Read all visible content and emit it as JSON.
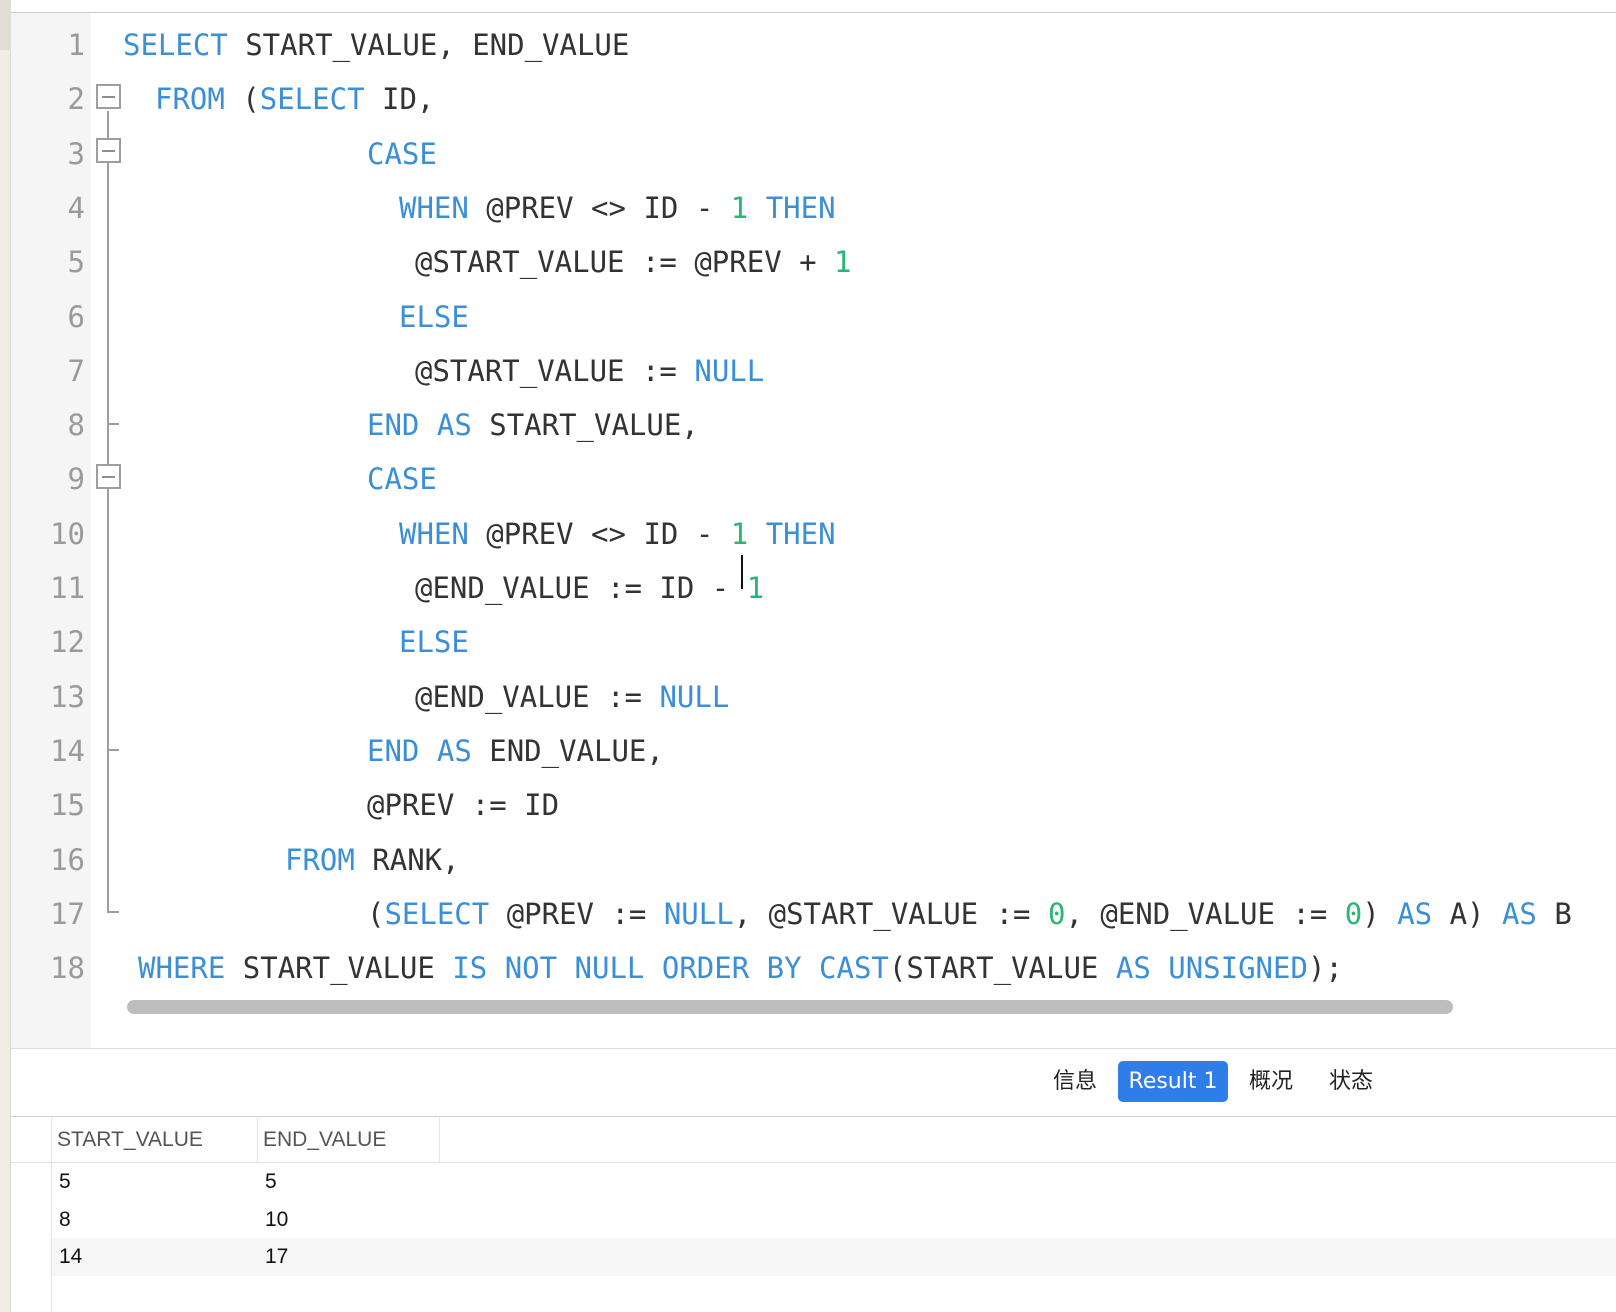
{
  "editor": {
    "lines": [
      {
        "num": "1",
        "tokens": [
          {
            "t": "SELECT",
            "k": "kw"
          },
          {
            "t": " START_VALUE, END_VALUE",
            "k": "id"
          }
        ]
      },
      {
        "num": "2",
        "tokens": [
          {
            "t": "FROM",
            "k": "kw"
          },
          {
            "t": " (",
            "k": "id"
          },
          {
            "t": "SELECT",
            "k": "kw"
          },
          {
            "t": " ID,",
            "k": "id"
          }
        ]
      },
      {
        "num": "3",
        "tokens": [
          {
            "t": "CASE",
            "k": "kw"
          }
        ]
      },
      {
        "num": "4",
        "tokens": [
          {
            "t": "WHEN",
            "k": "kw"
          },
          {
            "t": " @PREV <> ID - ",
            "k": "id"
          },
          {
            "t": "1",
            "k": "num"
          },
          {
            "t": " ",
            "k": "id"
          },
          {
            "t": "THEN",
            "k": "kw"
          }
        ]
      },
      {
        "num": "5",
        "tokens": [
          {
            "t": "@START_VALUE := @PREV + ",
            "k": "id"
          },
          {
            "t": "1",
            "k": "num"
          }
        ]
      },
      {
        "num": "6",
        "tokens": [
          {
            "t": "ELSE",
            "k": "kw"
          }
        ]
      },
      {
        "num": "7",
        "tokens": [
          {
            "t": "@START_VALUE := ",
            "k": "id"
          },
          {
            "t": "NULL",
            "k": "kw"
          }
        ]
      },
      {
        "num": "8",
        "tokens": [
          {
            "t": "END",
            "k": "kw"
          },
          {
            "t": " ",
            "k": "id"
          },
          {
            "t": "AS",
            "k": "kw"
          },
          {
            "t": " START_VALUE,",
            "k": "id"
          }
        ]
      },
      {
        "num": "9",
        "tokens": [
          {
            "t": "CASE",
            "k": "kw"
          }
        ]
      },
      {
        "num": "10",
        "tokens": [
          {
            "t": "WHEN",
            "k": "kw"
          },
          {
            "t": " @PREV <> ID - ",
            "k": "id"
          },
          {
            "t": "1",
            "k": "num"
          },
          {
            "t": " ",
            "k": "id"
          },
          {
            "t": "THEN",
            "k": "kw"
          }
        ]
      },
      {
        "num": "11",
        "tokens": [
          {
            "t": "@END_VALUE := ID - ",
            "k": "id"
          },
          {
            "t": "1",
            "k": "num"
          }
        ]
      },
      {
        "num": "12",
        "tokens": [
          {
            "t": "ELSE",
            "k": "kw"
          }
        ]
      },
      {
        "num": "13",
        "tokens": [
          {
            "t": "@END_VALUE := ",
            "k": "id"
          },
          {
            "t": "NULL",
            "k": "kw"
          }
        ]
      },
      {
        "num": "14",
        "tokens": [
          {
            "t": "END",
            "k": "kw"
          },
          {
            "t": " ",
            "k": "id"
          },
          {
            "t": "AS",
            "k": "kw"
          },
          {
            "t": " END_VALUE,",
            "k": "id"
          }
        ]
      },
      {
        "num": "15",
        "tokens": [
          {
            "t": "@PREV := ID",
            "k": "id"
          }
        ]
      },
      {
        "num": "16",
        "tokens": [
          {
            "t": "FROM",
            "k": "kw"
          },
          {
            "t": " RANK,",
            "k": "id"
          }
        ]
      },
      {
        "num": "17",
        "tokens": [
          {
            "t": "(",
            "k": "id"
          },
          {
            "t": "SELECT",
            "k": "kw"
          },
          {
            "t": " @PREV := ",
            "k": "id"
          },
          {
            "t": "NULL",
            "k": "kw"
          },
          {
            "t": ", @START_VALUE := ",
            "k": "id"
          },
          {
            "t": "0",
            "k": "num"
          },
          {
            "t": ", @END_VALUE := ",
            "k": "id"
          },
          {
            "t": "0",
            "k": "num"
          },
          {
            "t": ") ",
            "k": "id"
          },
          {
            "t": "AS",
            "k": "kw"
          },
          {
            "t": " A) ",
            "k": "id"
          },
          {
            "t": "AS",
            "k": "kw"
          },
          {
            "t": " B",
            "k": "id"
          }
        ]
      },
      {
        "num": "18",
        "tokens": [
          {
            "t": "WHERE",
            "k": "kw"
          },
          {
            "t": " START_VALUE ",
            "k": "id"
          },
          {
            "t": "IS",
            "k": "kw"
          },
          {
            "t": " ",
            "k": "id"
          },
          {
            "t": "NOT",
            "k": "kw"
          },
          {
            "t": " ",
            "k": "id"
          },
          {
            "t": "NULL",
            "k": "kw"
          },
          {
            "t": " ",
            "k": "id"
          },
          {
            "t": "ORDER",
            "k": "kw"
          },
          {
            "t": " ",
            "k": "id"
          },
          {
            "t": "BY",
            "k": "kw"
          },
          {
            "t": " ",
            "k": "id"
          },
          {
            "t": "CAST",
            "k": "kw"
          },
          {
            "t": "(START_VALUE ",
            "k": "id"
          },
          {
            "t": "AS",
            "k": "kw"
          },
          {
            "t": " ",
            "k": "id"
          },
          {
            "t": "UNSIGNED",
            "k": "kw"
          },
          {
            "t": ");",
            "k": "id"
          }
        ]
      }
    ],
    "colors": {
      "kw": "#3b8fd8",
      "id": "#333333",
      "num": "#2bb673"
    }
  },
  "tabs": [
    {
      "label": "信息",
      "active": false
    },
    {
      "label": "Result 1",
      "active": true
    },
    {
      "label": "概况",
      "active": false
    },
    {
      "label": "状态",
      "active": false
    }
  ],
  "results": {
    "columns": [
      "START_VALUE",
      "END_VALUE"
    ],
    "rows": [
      [
        "5",
        "5"
      ],
      [
        "8",
        "10"
      ],
      [
        "14",
        "17"
      ]
    ]
  }
}
